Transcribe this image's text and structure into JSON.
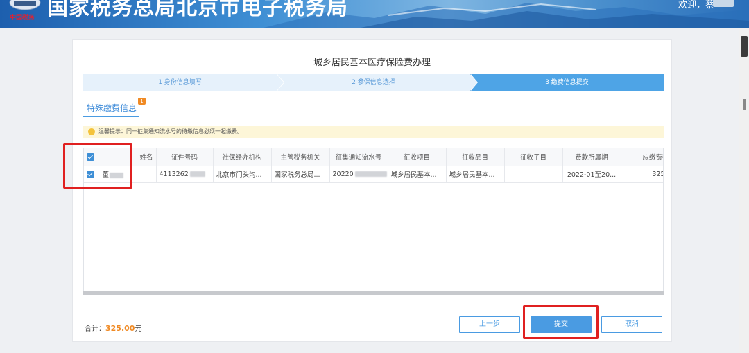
{
  "header": {
    "title": "国家税务总局北京市电子税务局",
    "emblem_text": "中国税务",
    "welcome": "欢迎，",
    "user": "蔡"
  },
  "page": {
    "title": "城乡居民基本医疗保险费办理"
  },
  "steps": [
    {
      "label": "1 身份信息填写",
      "active": false
    },
    {
      "label": "2 参保信息选择",
      "active": false
    },
    {
      "label": "3 缴费信息提交",
      "active": true
    }
  ],
  "tab": {
    "label": "特殊缴费信息",
    "badge": "1"
  },
  "notice": "温馨提示：同一征集通知流水号的待缴信息必须一起缴费。",
  "table": {
    "headers": [
      "姓名",
      "证件号码",
      "社保经办机构",
      "主管税务机关",
      "征集通知流水号",
      "征收项目",
      "征收品目",
      "征收子目",
      "费款所属期",
      "应缴费额"
    ],
    "rows": [
      {
        "checked": true,
        "name": "董",
        "id_number": "4113262",
        "agency": "北京市门头沟...",
        "tax_office": "国家税务总局...",
        "serial": "20220",
        "item": "城乡居民基本...",
        "category": "城乡居民基本...",
        "subcategory": "",
        "period": "2022-01至20...",
        "amount": "325"
      }
    ]
  },
  "footer": {
    "total_label": "合计：",
    "total_amount": "325.00",
    "total_unit": "元",
    "prev_label": "上一步",
    "submit_label": "提交",
    "cancel_label": "取消"
  },
  "colors": {
    "accent": "#4a9be2",
    "highlight": "#e02020",
    "amount": "#f08a24"
  }
}
